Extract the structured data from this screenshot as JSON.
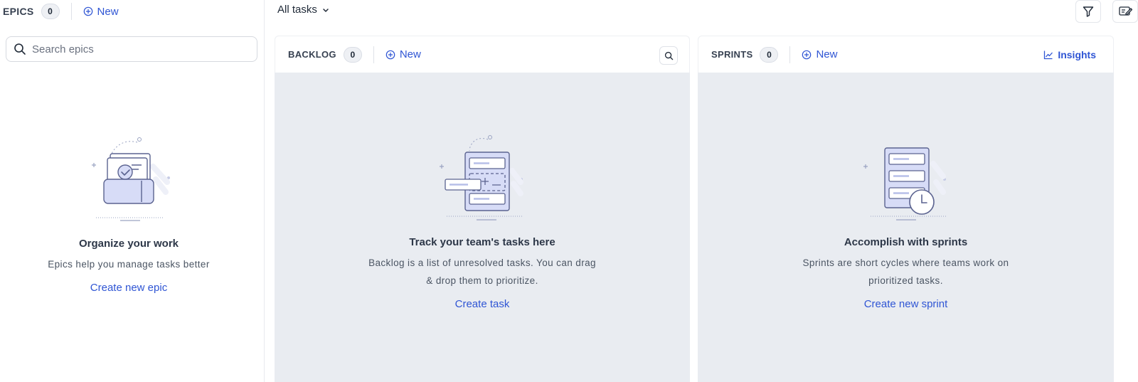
{
  "epics": {
    "title": "EPICS",
    "count": "0",
    "new_label": "New",
    "search_placeholder": "Search epics",
    "empty": {
      "heading": "Organize your work",
      "text": "Epics help you manage tasks better",
      "cta": "Create new epic"
    }
  },
  "topbar": {
    "view_select": "All tasks",
    "icons": [
      "filter-icon",
      "edit-notes-icon"
    ]
  },
  "backlog": {
    "title": "BACKLOG",
    "count": "0",
    "new_label": "New",
    "empty": {
      "heading": "Track your team's tasks here",
      "text_line1": "Backlog is a list of unresolved tasks. You can drag",
      "text_line2": "& drop them to prioritize.",
      "cta": "Create task"
    }
  },
  "sprints": {
    "title": "SPRINTS",
    "count": "0",
    "new_label": "New",
    "insights_label": "Insights",
    "empty": {
      "heading": "Accomplish with sprints",
      "text_line1": "Sprints are short cycles where teams work on",
      "text_line2": "prioritized tasks.",
      "cta": "Create new sprint"
    }
  },
  "colors": {
    "accent": "#2f55d4",
    "panel_bg": "#e9ecf1",
    "illustration_fill": "#d7dcf7",
    "illustration_stroke": "#5b6390"
  }
}
